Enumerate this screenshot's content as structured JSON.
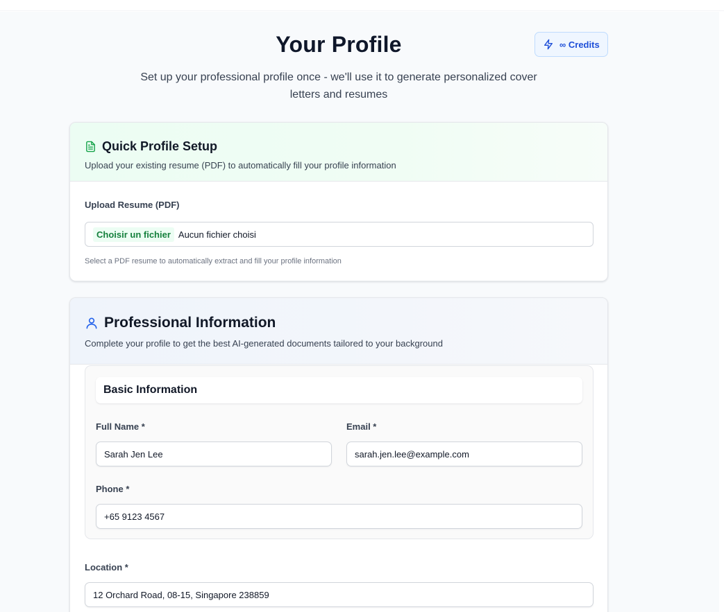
{
  "header": {
    "title": "Your Profile",
    "subtitle": "Set up your professional profile once - we'll use it to generate personalized cover letters and resumes",
    "credits": {
      "icon": "lightning-icon",
      "label": "∞ Credits"
    }
  },
  "quick_setup": {
    "icon": "document-icon",
    "title": "Quick Profile Setup",
    "description": "Upload your existing resume (PDF) to automatically fill your profile information",
    "upload_label": "Upload Resume (PDF)",
    "file_button": "Choisir un fichier",
    "file_status": "Aucun fichier choisi",
    "hint": "Select a PDF resume to automatically extract and fill your profile information"
  },
  "professional": {
    "icon": "user-icon",
    "title": "Professional Information",
    "description": "Complete your profile to get the best AI-generated documents tailored to your background",
    "basic": {
      "title": "Basic Information",
      "full_name_label": "Full Name *",
      "full_name_value": "Sarah Jen Lee",
      "email_label": "Email *",
      "email_value": "sarah.jen.lee@example.com",
      "phone_label": "Phone *",
      "phone_value": "+65 9123 4567"
    },
    "location_label": "Location *",
    "location_value": "12 Orchard Road, 08-15, Singapore 238859"
  },
  "colors": {
    "accent_blue": "#1d4ed8",
    "accent_green": "#15803d",
    "quick_header_bg": "#ecfdf3",
    "pro_header_bg": "#eff4fb"
  }
}
